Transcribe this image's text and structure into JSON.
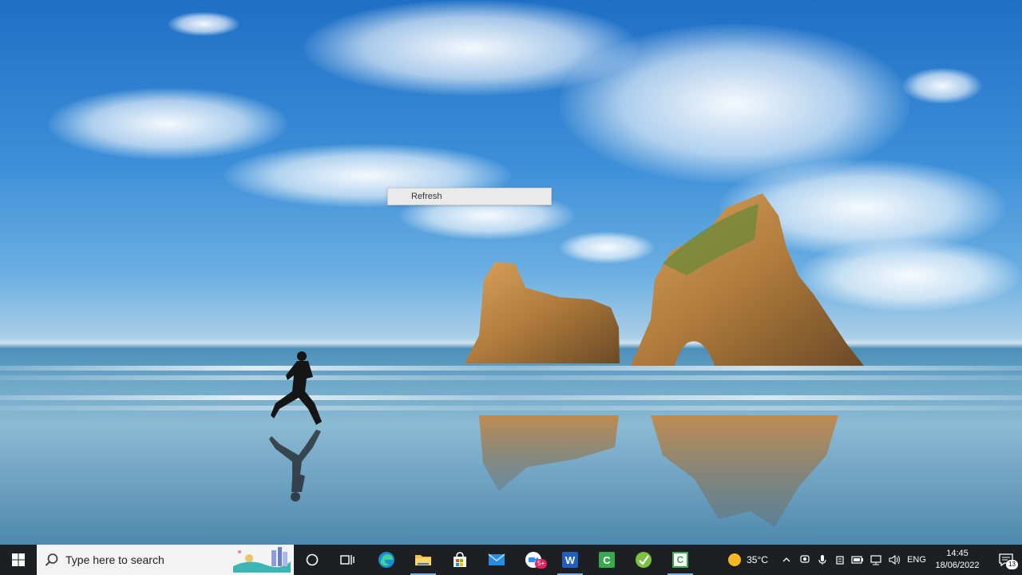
{
  "context_menu": {
    "items": [
      {
        "label": "Refresh"
      }
    ]
  },
  "taskbar": {
    "search": {
      "placeholder": "Type here to search"
    },
    "pinned_apps": [
      {
        "name": "Microsoft Edge"
      },
      {
        "name": "File Explorer"
      },
      {
        "name": "Microsoft Store"
      },
      {
        "name": "Mail"
      },
      {
        "name": "Zoom",
        "badge": "5+"
      },
      {
        "name": "Word",
        "letter": "W"
      },
      {
        "name": "Camtasia",
        "letter": "C"
      },
      {
        "name": "Greenshot"
      },
      {
        "name": "Camtasia Recorder",
        "letter": "C"
      }
    ],
    "weather": {
      "temperature": "35°C"
    },
    "tray": {
      "language": "ENG"
    },
    "clock": {
      "time": "14:45",
      "date": "18/06/2022"
    },
    "notifications": {
      "count": "13"
    }
  }
}
